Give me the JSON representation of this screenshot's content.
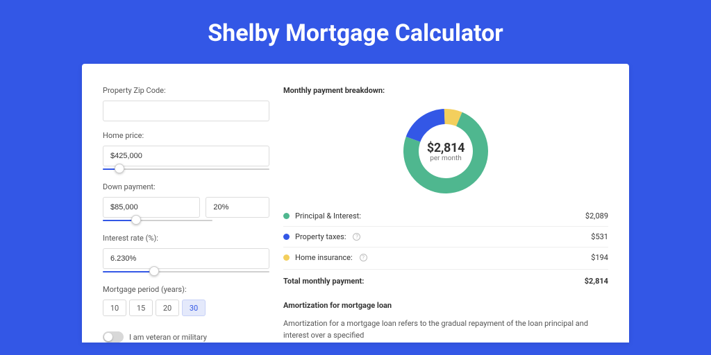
{
  "title": "Shelby Mortgage Calculator",
  "form": {
    "zip_label": "Property Zip Code:",
    "zip_value": "",
    "home_price_label": "Home price:",
    "home_price_value": "$425,000",
    "down_payment_label": "Down payment:",
    "down_payment_value": "$85,000",
    "down_payment_pct": "20%",
    "interest_label": "Interest rate (%):",
    "interest_value": "6.230%",
    "period_label": "Mortgage period (years):",
    "period_options": [
      "10",
      "15",
      "20",
      "30"
    ],
    "period_selected": "30",
    "veteran_label": "I am veteran or military"
  },
  "breakdown": {
    "heading": "Monthly payment breakdown:",
    "donut_amount": "$2,814",
    "donut_sub": "per month",
    "items": [
      {
        "label": "Principal & Interest:",
        "value": "$2,089",
        "color": "#4fb78f",
        "help": false
      },
      {
        "label": "Property taxes:",
        "value": "$531",
        "color": "#3357e6",
        "help": true
      },
      {
        "label": "Home insurance:",
        "value": "$194",
        "color": "#f3cf5d",
        "help": true
      }
    ],
    "total_label": "Total monthly payment:",
    "total_value": "$2,814"
  },
  "amort": {
    "heading": "Amortization for mortgage loan",
    "desc": "Amortization for a mortgage loan refers to the gradual repayment of the loan principal and interest over a specified"
  },
  "chart_data": {
    "type": "pie",
    "title": "Monthly payment breakdown",
    "series": [
      {
        "name": "Principal & Interest",
        "value": 2089,
        "color": "#4fb78f"
      },
      {
        "name": "Property taxes",
        "value": 531,
        "color": "#3357e6"
      },
      {
        "name": "Home insurance",
        "value": 194,
        "color": "#f3cf5d"
      }
    ],
    "total": 2814,
    "center_label": "$2,814 per month"
  }
}
